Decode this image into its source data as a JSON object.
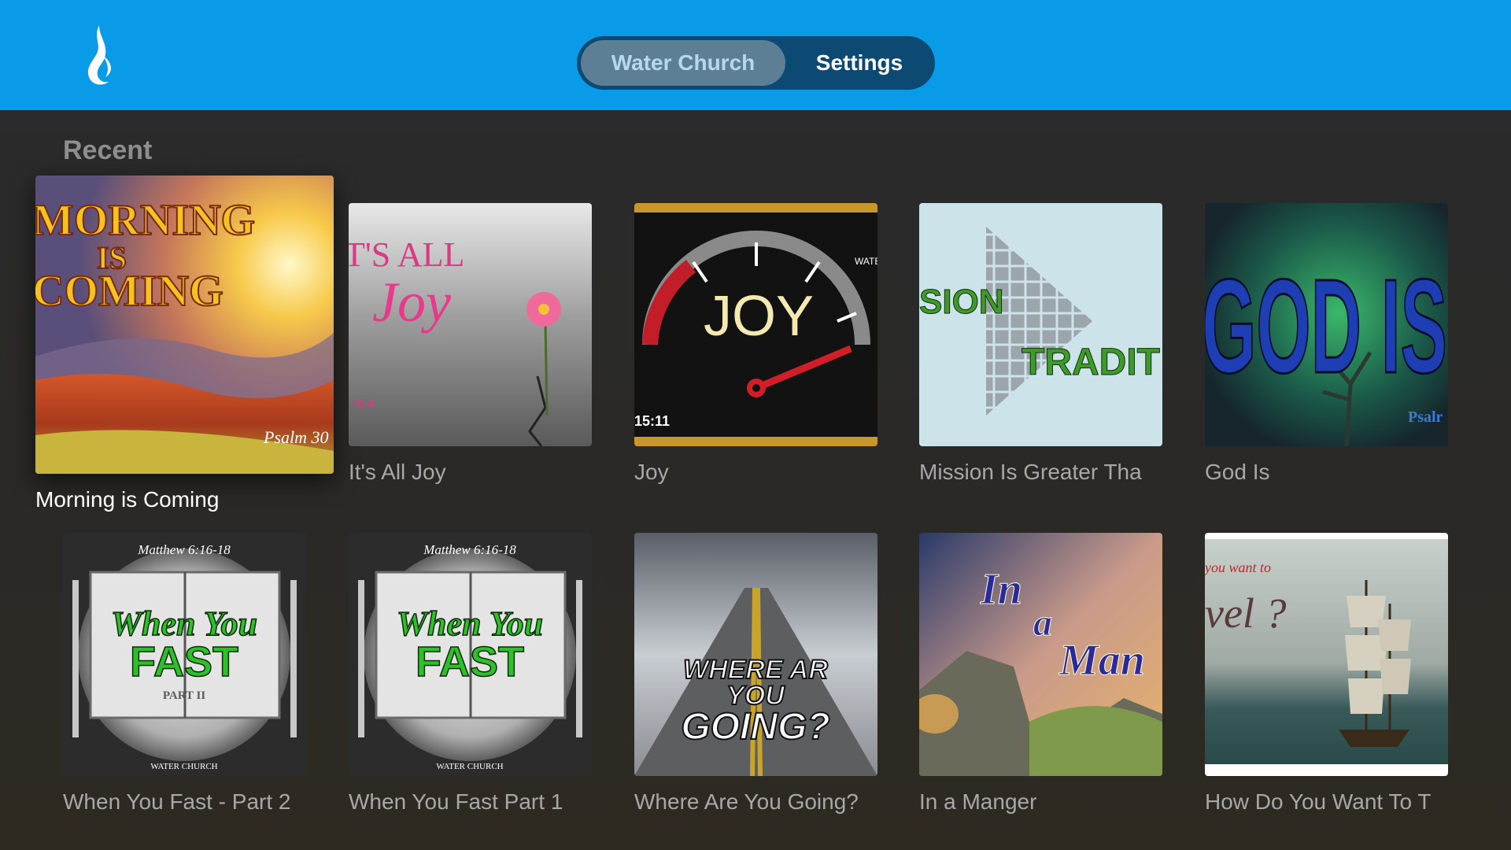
{
  "app": {
    "logo_icon": "water-flame-logo-icon"
  },
  "tabs": [
    {
      "label": "Water Church",
      "active": true
    },
    {
      "label": "Settings",
      "active": false
    }
  ],
  "section": {
    "title": "Recent"
  },
  "row1": [
    {
      "title": "Morning is Coming",
      "art_text_1": "MORNING",
      "art_text_2": "IS",
      "art_text_3": "COMING",
      "art_ref": "Psalm 30"
    },
    {
      "title": "It's All Joy",
      "art_text_1": "T'S ALL",
      "art_text_2": "Joy",
      "art_ref": ":2-4"
    },
    {
      "title": "Joy",
      "art_text_1": "JOY",
      "art_ref": "15:11",
      "art_small": "WATE"
    },
    {
      "title": "Mission Is Greater Tha",
      "art_text_1": "SION",
      "art_text_2": "TRADIT"
    },
    {
      "title": "God Is",
      "art_text_1": "GOD IS",
      "art_ref": "Psalr"
    }
  ],
  "row2": [
    {
      "title": "When You Fast - Part 2",
      "art_ref": "Matthew 6:16-18",
      "art_text_1": "When You",
      "art_text_2": "FAST",
      "art_part": "PART II",
      "art_brand": "WATER CHURCH"
    },
    {
      "title": "When You Fast Part 1",
      "art_ref": "Matthew 6:16-18",
      "art_text_1": "When You",
      "art_text_2": "FAST",
      "art_brand": "WATER CHURCH"
    },
    {
      "title": "Where Are You Going?",
      "art_text_1": "WHERE AR",
      "art_text_2": "YOU",
      "art_text_3": "GOING?"
    },
    {
      "title": "In a Manger",
      "art_text_1": "In",
      "art_text_2": "a",
      "art_text_3": "Man"
    },
    {
      "title": "How Do You Want To T",
      "art_text_1": "you want to",
      "art_text_2": "vel ?"
    }
  ]
}
